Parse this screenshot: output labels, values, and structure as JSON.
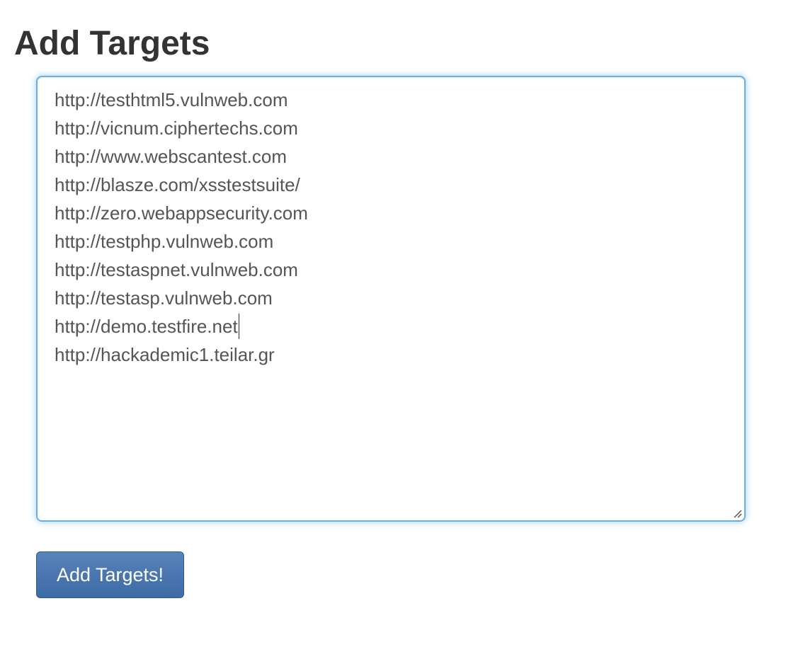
{
  "page": {
    "title": "Add Targets"
  },
  "targets_field": {
    "lines": [
      "http://testhtml5.vulnweb.com",
      "http://vicnum.ciphertechs.com",
      "http://www.webscantest.com",
      "http://blasze.com/xsstestsuite/",
      "http://zero.webappsecurity.com",
      "http://testphp.vulnweb.com",
      "http://testaspnet.vulnweb.com",
      "http://testasp.vulnweb.com",
      "http://demo.testfire.net",
      "http://hackademic1.teilar.gr"
    ],
    "focus_color": "#66afe9"
  },
  "submit": {
    "label": "Add Targets!",
    "color": "#4a76b0"
  },
  "icons": {
    "resize": "resize-handle-icon"
  }
}
